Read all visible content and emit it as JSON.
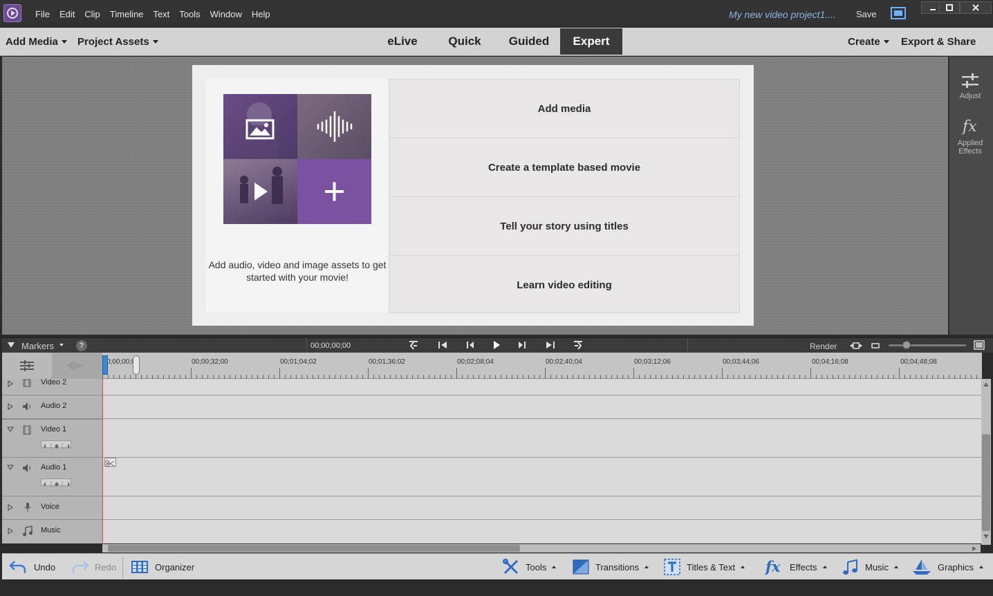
{
  "app": {
    "menu": [
      "File",
      "Edit",
      "Clip",
      "Timeline",
      "Text",
      "Tools",
      "Window",
      "Help"
    ],
    "project_title": "My new video project1....",
    "save_label": "Save"
  },
  "modebar": {
    "add_media": "Add Media",
    "project_assets": "Project Assets",
    "tabs": [
      "eLive",
      "Quick",
      "Guided",
      "Expert"
    ],
    "active_tab": "Expert",
    "create": "Create",
    "export_share": "Export & Share"
  },
  "right_panel": {
    "adjust": "Adjust",
    "applied_effects": "Applied Effects"
  },
  "welcome": {
    "description": "Add audio, video and image assets to get started with your movie!",
    "options": [
      "Add media",
      "Create a template based movie",
      "Tell your story using titles",
      "Learn video editing"
    ]
  },
  "transport": {
    "markers": "Markers",
    "help": "?",
    "timecode": "00;00;00;00",
    "render": "Render"
  },
  "ruler": {
    "labels": [
      "0;00;00;00",
      "00;00;32;00",
      "00;01;04;02",
      "00;01;36;02",
      "00;02;08;04",
      "00;02;40;04",
      "00;03;12;06",
      "00;03;44;06",
      "00;04;16;08",
      "00;04;48;08"
    ]
  },
  "tracks": [
    {
      "name": "Video 2"
    },
    {
      "name": "Audio 2"
    },
    {
      "name": "Video 1"
    },
    {
      "name": "Audio 1"
    },
    {
      "name": "Voice"
    },
    {
      "name": "Music"
    }
  ],
  "bottombar": {
    "undo": "Undo",
    "redo": "Redo",
    "organizer": "Organizer",
    "tools": "Tools",
    "transitions": "Transitions",
    "titles_text": "Titles & Text",
    "effects": "Effects",
    "music": "Music",
    "graphics": "Graphics"
  },
  "colors": {
    "accent": "#7a4fa3",
    "playhead": "#d84a4a",
    "active_tab_bg": "#3a3a3a"
  }
}
